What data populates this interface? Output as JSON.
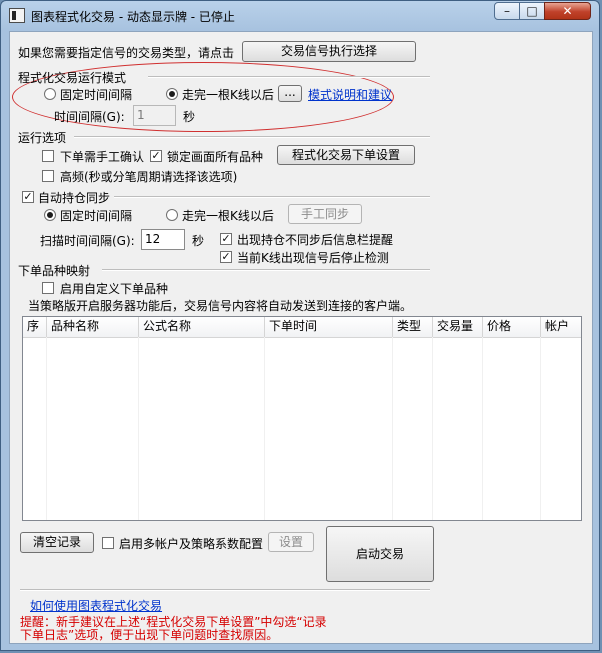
{
  "window": {
    "title": "图表程式化交易 - 动态显示牌 - 已停止",
    "min_glyph": "–",
    "max_glyph": "□",
    "close_glyph": "✕"
  },
  "intro": {
    "text": "如果您需要指定信号的交易类型，请点击",
    "button_label": "交易信号执行选择"
  },
  "mode": {
    "heading": "程式化交易运行模式",
    "radio_fixed": "固定时间间隔",
    "radio_kline": "走完一根K线以后",
    "ellipsis_button": "...",
    "link": "模式说明和建议",
    "interval_label": "时间间隔(G):",
    "interval_value": "1",
    "interval_unit": "秒"
  },
  "options": {
    "heading": "运行选项",
    "manual_confirm": "下单需手工确认",
    "lock_all": "锁定画面所有品种",
    "order_settings_button": "程式化交易下单设置",
    "high_freq": "高频(秒或分笔周期请选择该选项)"
  },
  "sync": {
    "heading": "自动持仓同步",
    "radio_fixed": "固定时间间隔",
    "radio_kline": "走完一根K线以后",
    "manual_sync_button": "手工同步",
    "scan_label": "扫描时间间隔(G):",
    "scan_value": "12",
    "scan_unit": "秒",
    "alert_mismatch": "出现持仓不同步后信息栏提醒",
    "stop_detect": "当前K线出现信号后停止检测"
  },
  "mapping": {
    "heading": "下单品种映射",
    "custom_enable": "启用自定义下单品种",
    "notice": "当策略版开启服务器功能后，交易信号内容将自动发送到连接的客户端。"
  },
  "table": {
    "columns": [
      "序",
      "品种名称",
      "公式名称",
      "下单时间",
      "类型",
      "交易量",
      "价格",
      "帐户"
    ],
    "rows": []
  },
  "bottom": {
    "clear_button": "清空记录",
    "multi_account": "启用多帐户及策略系数配置",
    "settings_button": "设置",
    "start_button": "启动交易"
  },
  "footer": {
    "help_link": "如何使用图表程式化交易",
    "tip_line1": "提醒：新手建议在上述“程式化交易下单设置”中勾选“记录",
    "tip_line2": "下单日志”选项，便于出现下单问题时查找原因。"
  },
  "colors": {
    "link": "#0033cc",
    "tip": "#d50000",
    "highlight_ellipse": "#d03030"
  }
}
